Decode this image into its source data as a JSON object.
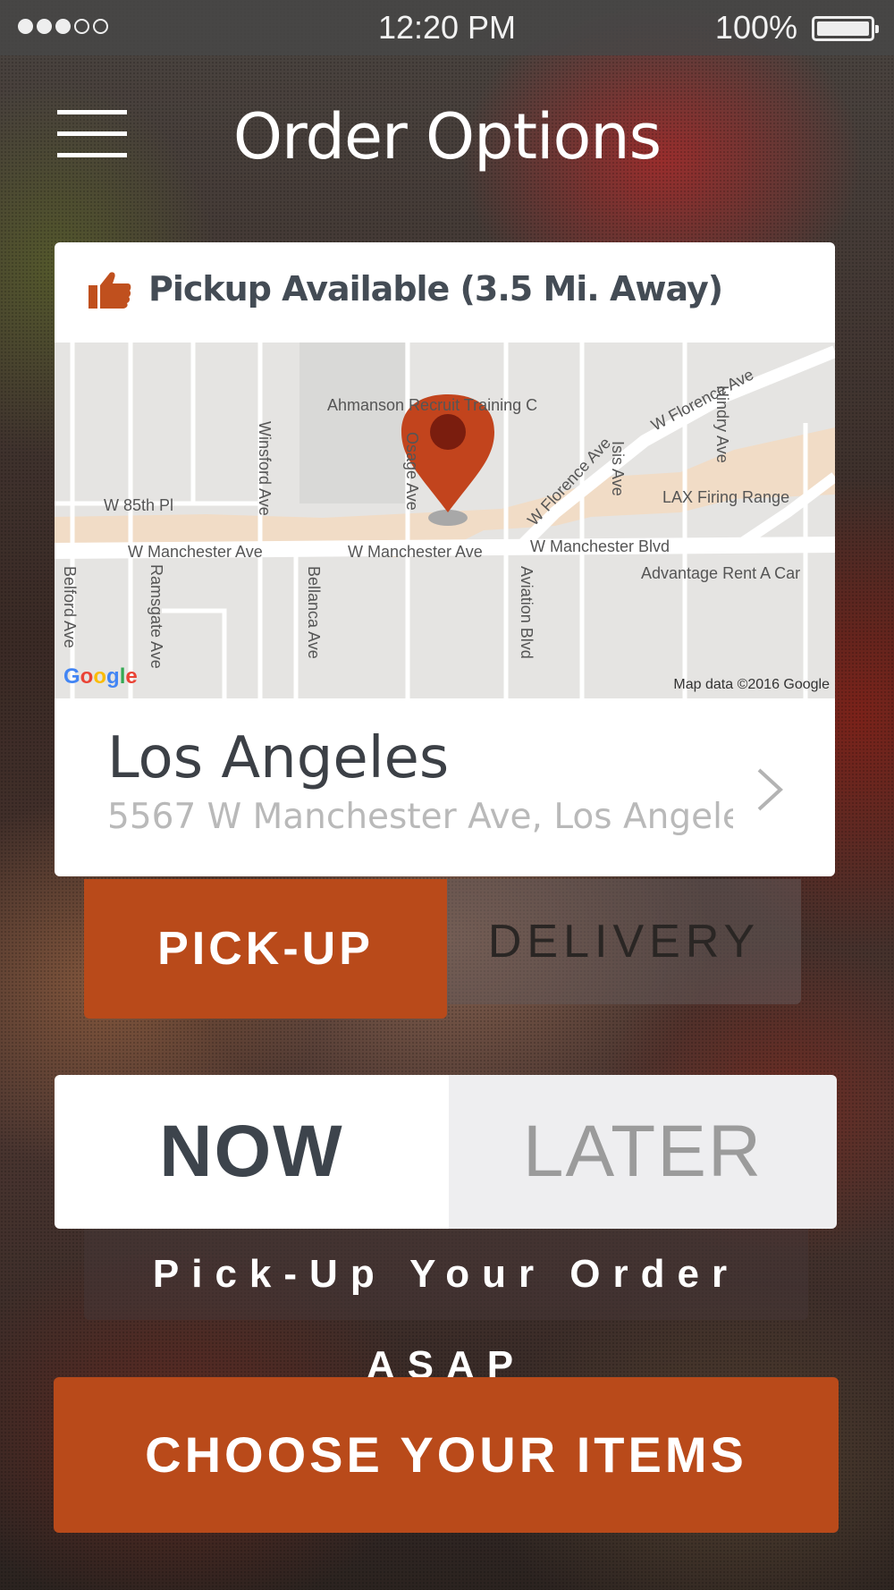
{
  "status_bar": {
    "time": "12:20 PM",
    "battery": "100%",
    "signal_bars": 3,
    "signal_total": 5
  },
  "header": {
    "title": "Order Options"
  },
  "location_card": {
    "availability": "Pickup Available (3.5 Mi. Away)",
    "city": "Los Angeles",
    "address": "5567 W Manchester Ave, Los Angele...",
    "map": {
      "labels": {
        "ahmanson": "Ahmanson Recruit Training C",
        "w_85th": "W 85th Pl",
        "w_manchester_ave_1": "W Manchester Ave",
        "w_manchester_ave_2": "W Manchester Ave",
        "w_manchester_blvd": "W Manchester Blvd",
        "w_florence_1": "W Florence Ave",
        "w_florence_2": "W Florence Ave",
        "winsford": "Winsford Ave",
        "osage": "Osage Ave",
        "isis": "Isis Ave",
        "hindry": "Hindry Ave",
        "lax_firing": "LAX Firing Range",
        "advantage": "Advantage Rent A Car",
        "belford": "Belford Ave",
        "ramsgate": "Ramsgate Ave",
        "bellanca": "Bellanca Ave",
        "aviation": "Aviation Blvd"
      },
      "logo": "Google",
      "attribution": "Map data ©2016 Google"
    }
  },
  "fulfillment": {
    "pickup_label": "PICK-UP",
    "delivery_label": "DELIVERY",
    "selected": "pickup"
  },
  "timing": {
    "now_label": "NOW",
    "later_label": "LATER",
    "selected": "now",
    "hint": "Pick-Up Your Order ASAP"
  },
  "cta": {
    "label": "CHOOSE YOUR ITEMS"
  },
  "colors": {
    "accent": "#b94a1a",
    "text_dark": "#3d444c",
    "muted": "#9b9b9b"
  }
}
